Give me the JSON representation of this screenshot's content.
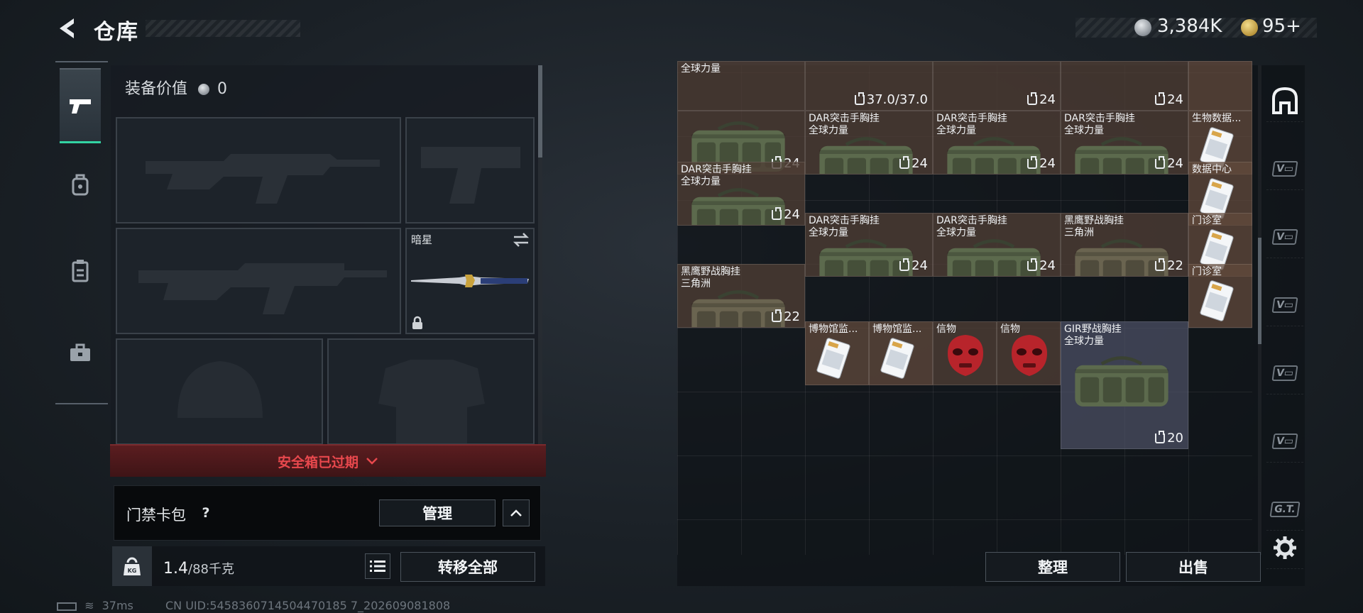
{
  "header": {
    "title": "仓库"
  },
  "currency": {
    "silver": "3,384K",
    "gold": "95+"
  },
  "equipment": {
    "value_label": "装备价值",
    "value": "0",
    "melee_label": "暗星",
    "safe_box_status": "安全箱已过期",
    "keycard_label": "门禁卡包",
    "keycard_help": "?",
    "manage_label": "管理"
  },
  "weight": {
    "current": "1.4",
    "max": "/88千克",
    "kg_icon": "KG"
  },
  "actions": {
    "transfer_all": "转移全部",
    "sort": "整理",
    "sell": "出售"
  },
  "stash": {
    "partial_top": [
      {
        "name": "全球力量",
        "cap": ""
      },
      {
        "name": "",
        "cap": "37.0/37.0"
      },
      {
        "name": "",
        "cap": "24"
      },
      {
        "name": "",
        "cap": "24"
      }
    ],
    "items": [
      {
        "name": "",
        "sub": "",
        "cap": "24",
        "type": "bag"
      },
      {
        "name": "DAR突击手胸挂",
        "sub": "全球力量",
        "cap": "24",
        "type": "bag"
      },
      {
        "name": "DAR突击手胸挂",
        "sub": "全球力量",
        "cap": "24",
        "type": "bag"
      },
      {
        "name": "DAR突击手胸挂",
        "sub": "全球力量",
        "cap": "24",
        "type": "bag"
      },
      {
        "name": "生物数据...",
        "sub": "",
        "cap": "",
        "type": "card"
      },
      {
        "name": "DAR突击手胸挂",
        "sub": "全球力量",
        "cap": "24",
        "type": "bag"
      },
      {
        "name": "数据中心",
        "sub": "",
        "cap": "",
        "type": "card"
      },
      {
        "name": "DAR突击手胸挂",
        "sub": "全球力量",
        "cap": "24",
        "type": "bag"
      },
      {
        "name": "DAR突击手胸挂",
        "sub": "全球力量",
        "cap": "24",
        "type": "bag"
      },
      {
        "name": "黑鹰野战胸挂",
        "sub": "三角洲",
        "cap": "22",
        "type": "bag"
      },
      {
        "name": "门诊室",
        "sub": "",
        "cap": "",
        "type": "card"
      },
      {
        "name": "黑鹰野战胸挂",
        "sub": "三角洲",
        "cap": "22",
        "type": "bag"
      },
      {
        "name": "门诊室",
        "sub": "",
        "cap": "",
        "type": "card"
      },
      {
        "name": "博物馆监...",
        "sub": "",
        "cap": "",
        "type": "card"
      },
      {
        "name": "博物馆监...",
        "sub": "",
        "cap": "",
        "type": "card"
      },
      {
        "name": "信物",
        "sub": "",
        "cap": "",
        "type": "mask"
      },
      {
        "name": "信物",
        "sub": "",
        "cap": "",
        "type": "mask"
      },
      {
        "name": "GIR野战胸挂",
        "sub": "全球力量",
        "cap": "20",
        "type": "bag"
      }
    ]
  },
  "sidebar_right": [
    "home-icon",
    "vault-1-icon",
    "vault-2-icon",
    "vault-3-icon",
    "vault-4-icon",
    "vault-5-icon",
    "gtl-vault-icon",
    "gear-icon"
  ],
  "status_bar": {
    "ping": "37ms",
    "uid": "CN UID:5458360714504470185 7_202609081808"
  },
  "colors": {
    "accent": "#33d3a2",
    "danger": "#e8484d",
    "bag_green": "#5c6a4d",
    "mask_red": "#b8242b"
  }
}
